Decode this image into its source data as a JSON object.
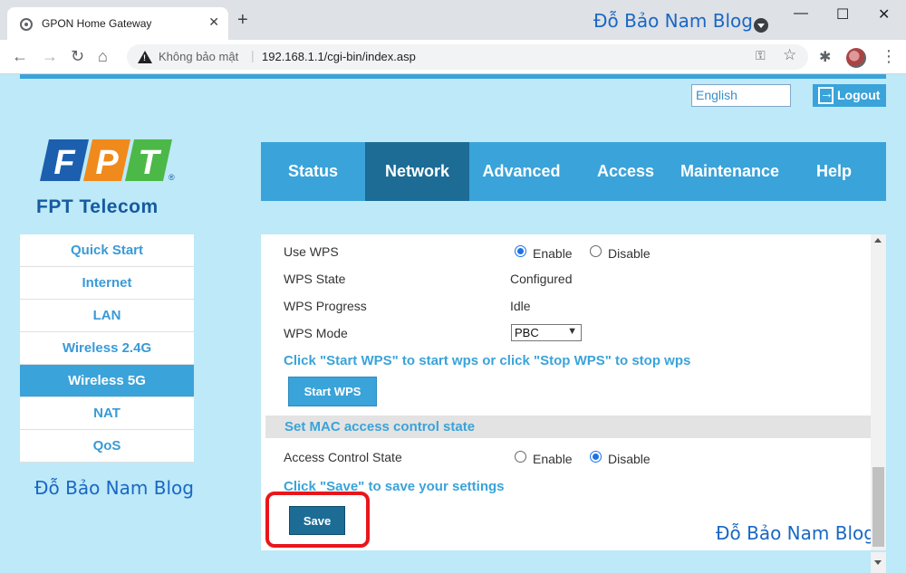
{
  "browser": {
    "tab_title": "GPON Home Gateway",
    "new_tab": "+",
    "watermark": "Đỗ Bảo Nam Blog",
    "security_warning": "Không bảo mật",
    "separator": "|",
    "url": "192.168.1.1/cgi-bin/index.asp",
    "controls": {
      "minimize": "—",
      "maximize": "☐",
      "close": "✕"
    }
  },
  "header": {
    "language": "English",
    "logout_label": "Logout",
    "logo_text": "FPT Telecom",
    "logo_letters": [
      "F",
      "P",
      "T"
    ],
    "logo_reg": "®",
    "colors": {
      "blue": "#1c5fae",
      "orange": "#f08a1c",
      "green": "#4cb848"
    }
  },
  "nav": {
    "items": [
      "Status",
      "Network",
      "Advanced",
      "Access",
      "Maintenance",
      "Help"
    ],
    "active": "Network"
  },
  "sidebar": {
    "items": [
      "Quick Start",
      "Internet",
      "LAN",
      "Wireless 2.4G",
      "Wireless 5G",
      "NAT",
      "QoS"
    ],
    "active": "Wireless 5G",
    "watermark": "Đỗ Bảo Nam Blog"
  },
  "wps": {
    "use_wps_label": "Use WPS",
    "enable_label": "Enable",
    "disable_label": "Disable",
    "use_wps_value": "Enable",
    "state_label": "WPS State",
    "state_value": "Configured",
    "progress_label": "WPS Progress",
    "progress_value": "Idle",
    "mode_label": "WPS Mode",
    "mode_value": "PBC",
    "instructions": "Click \"Start WPS\" to start wps or click \"Stop WPS\" to stop wps",
    "start_button": "Start WPS"
  },
  "mac": {
    "section_title": "Set MAC access control state",
    "label": "Access Control State",
    "enable_label": "Enable",
    "disable_label": "Disable",
    "value": "Disable"
  },
  "save": {
    "instructions": "Click \"Save\" to save your settings",
    "button": "Save"
  },
  "content_watermark": "Đỗ Bảo Nam Blog",
  "accent_colors": {
    "primary": "#3aa3d9",
    "active": "#1c6c96",
    "highlight": "#e8161c"
  }
}
